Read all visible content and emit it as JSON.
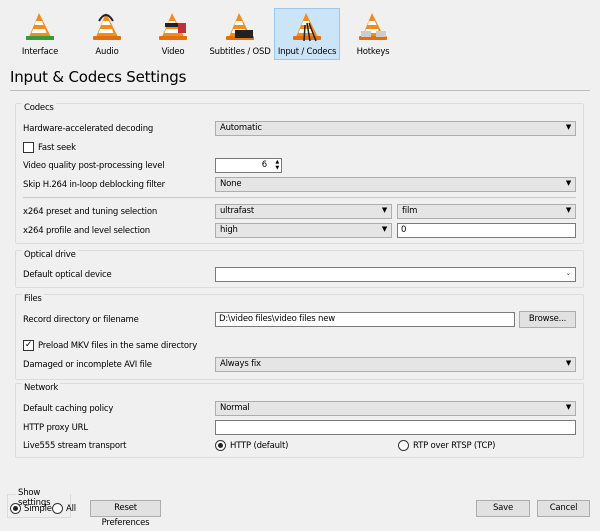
{
  "tabs": [
    {
      "label": "Interface",
      "icon": "vlc-cone-interface-icon"
    },
    {
      "label": "Audio",
      "icon": "vlc-cone-headphones-icon"
    },
    {
      "label": "Video",
      "icon": "vlc-cone-glasses-icon"
    },
    {
      "label": "Subtitles / OSD",
      "icon": "vlc-cone-subtitles-icon"
    },
    {
      "label": "Input / Codecs",
      "icon": "vlc-cone-cables-icon",
      "selected": true
    },
    {
      "label": "Hotkeys",
      "icon": "vlc-cone-keyboard-icon"
    }
  ],
  "title": "Input & Codecs Settings",
  "codecs": {
    "label": "Codecs",
    "hw_label": "Hardware-accelerated decoding",
    "hw_value": "Automatic",
    "fast_seek_label": "Fast seek",
    "fast_seek_checked": false,
    "vq_label": "Video quality post-processing level",
    "vq_value": "6",
    "skip_label": "Skip H.264 in-loop deblocking filter",
    "skip_value": "None",
    "preset_label": "x264 preset and tuning selection",
    "preset_value": "ultrafast",
    "tuning_value": "film",
    "profile_label": "x264 profile and level selection",
    "profile_value": "high",
    "level_value": "0"
  },
  "optical": {
    "label": "Optical drive",
    "device_label": "Default optical device",
    "device_value": ""
  },
  "files": {
    "label": "Files",
    "record_label": "Record directory or filename",
    "record_value": "D:\\video files\\video files new",
    "browse": "Browse...",
    "preload_label": "Preload MKV files in the same directory",
    "preload_checked": true,
    "avi_label": "Damaged or incomplete AVI file",
    "avi_value": "Always fix"
  },
  "network": {
    "label": "Network",
    "caching_label": "Default caching policy",
    "caching_value": "Normal",
    "proxy_label": "HTTP proxy URL",
    "proxy_value": "",
    "live_label": "Live555 stream transport",
    "opt_http": "HTTP (default)",
    "opt_rtp": "RTP over RTSP (TCP)",
    "selected": "HTTP (default)"
  },
  "footer": {
    "show_settings": "Show settings",
    "simple": "Simple",
    "all": "All",
    "selected": "Simple",
    "reset": "Reset Preferences",
    "save": "Save",
    "cancel": "Cancel"
  },
  "colors": {
    "cone_orange": "#f28c1c",
    "selected_tab": "#cce4f7"
  }
}
